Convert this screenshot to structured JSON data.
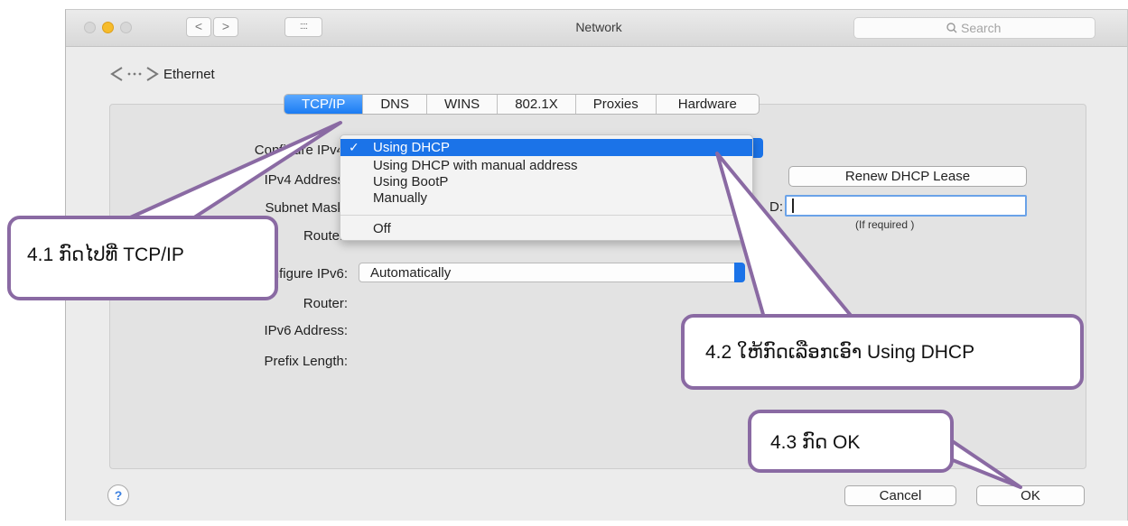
{
  "window": {
    "title": "Network",
    "search_placeholder": "Search",
    "back_glyph": "<",
    "forward_glyph": ">",
    "grid_glyph": "::::"
  },
  "header": {
    "icon": "network-arrows-icon",
    "label": "Ethernet"
  },
  "tabs": [
    {
      "label": "TCP/IP",
      "active": true
    },
    {
      "label": "DNS",
      "active": false
    },
    {
      "label": "WINS",
      "active": false
    },
    {
      "label": "802.1X",
      "active": false
    },
    {
      "label": "Proxies",
      "active": false
    },
    {
      "label": "Hardware",
      "active": false
    }
  ],
  "fields": {
    "configure_ipv4": "Configure IPv4",
    "ipv4_address": "IPv4 Address",
    "subnet_mask": "Subnet Mask",
    "router": "Router",
    "configure_ipv6": "Configure IPv6:",
    "router6": "Router:",
    "ipv6_address": "IPv6 Address:",
    "prefix_length": "Prefix Length:",
    "dhcp_client_suffix": "D:"
  },
  "ipv4_menu": {
    "check": "✓",
    "items": [
      {
        "label": "Using DHCP",
        "selected": true
      },
      {
        "label": "Using DHCP with manual address",
        "selected": false
      },
      {
        "label": "Using BootP",
        "selected": false
      },
      {
        "label": "Manually",
        "selected": false
      },
      {
        "label": "Off",
        "selected": false
      }
    ]
  },
  "renew_button": "Renew DHCP Lease",
  "if_required": "(If required )",
  "ipv6_value": "Automatically",
  "footer": {
    "help": "?",
    "cancel": "Cancel",
    "ok": "OK"
  },
  "callouts": {
    "step1": "4.1 ກົດໄປທີ່ TCP/IP",
    "step2": "4.2 ໃຫ້ກົດເລືອກເອົາ Using DHCP",
    "step3": "4.3 ກົດ OK"
  },
  "colors": {
    "accent": "#1b73e8",
    "callout_border": "#8a6aa3",
    "window_bg": "#ececec"
  }
}
